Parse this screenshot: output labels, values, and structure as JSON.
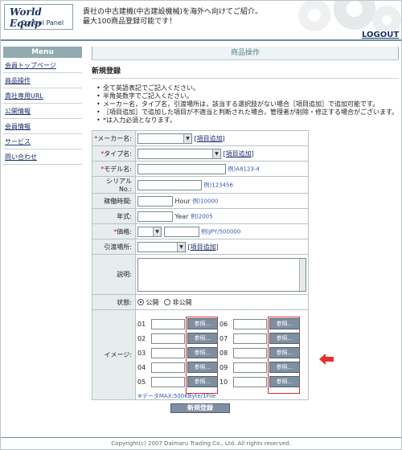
{
  "header": {
    "logo_title": "World Equip",
    "logo_sub": "Control Panel",
    "line1": "貴社の中古建機(中古建設機械)を海外へ向けてご紹介。",
    "line2": "最大100商品登録可能です！",
    "logout": "LOGOUT"
  },
  "sidebar": {
    "heading": "Menu",
    "items": [
      "会員トップページ",
      "商品操作",
      "貴社専用URL",
      "公開情報",
      "会員情報",
      "サービス",
      "問い合わせ"
    ]
  },
  "main": {
    "page_title": "商品操作",
    "section_title": "新規登録",
    "notes": [
      "全て英語表記でご記入ください。",
      "半角英数字でご記入ください。",
      "メーカー名，タイプ名，引渡場所は，該当する選択肢がない場合［項目追加］で追加可能です。",
      "［項目追加］で追加した項目が不適当と判断された場合，管理者が削除・修正する場合がございます。",
      "*は入力必須となります。"
    ]
  },
  "form": {
    "add_item": "項目追加",
    "maker_label": "メーカー名:",
    "type_label": "タイプ名:",
    "model_label": "モデル名:",
    "model_example": "例)A8123-4",
    "serial_label": "シリアルNo.:",
    "serial_example": "例)123456",
    "hours_label": "稼働時間:",
    "hours_unit": "Hour",
    "hours_example": "例)10000",
    "year_label": "年式:",
    "year_unit": "Year",
    "year_example": "例)2005",
    "price_label": "価格:",
    "price_example": "例)JPY/500000",
    "location_label": "引渡場所:",
    "desc_label": "説明:",
    "status_label": "状態:",
    "status_public": "公開",
    "status_private": "非公開",
    "image_label": "イメージ:",
    "browse_label": "参照...",
    "image_numbers_left": [
      "01",
      "02",
      "03",
      "04",
      "05"
    ],
    "image_numbers_right": [
      "06",
      "07",
      "08",
      "09",
      "10"
    ],
    "data_max": "※データMAX:500KByte/1File",
    "submit": "新規登録"
  },
  "footer": {
    "copyright": "Copyright(c) 2007 Daimaru Trading Co., Ltd. All rights reserved."
  },
  "colors": {
    "accent": "#92abb0",
    "button": "#7e8fa1",
    "highlight": "#d23030",
    "required": "#c8102e"
  }
}
